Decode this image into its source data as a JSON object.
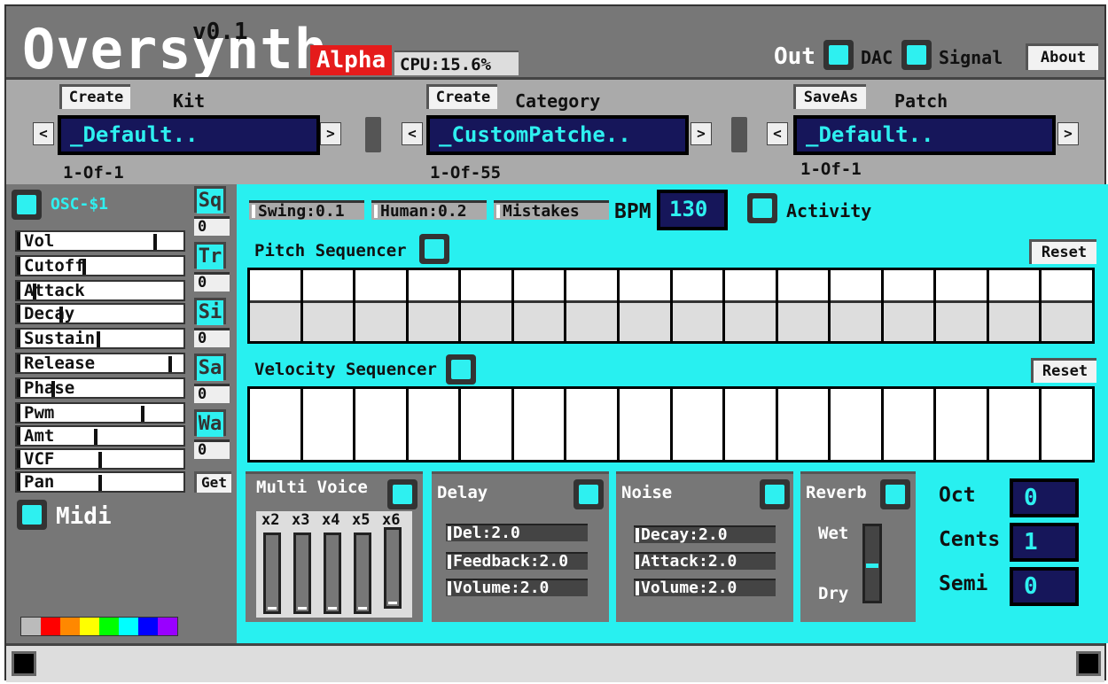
{
  "app": {
    "title": "Oversynth",
    "version": "v0.1",
    "stage": "Alpha",
    "cpu": "CPU:15.6%"
  },
  "header": {
    "out_label": "Out",
    "dac_label": "DAC",
    "signal_label": "Signal",
    "about_label": "About"
  },
  "patchbar": {
    "kit": {
      "button": "Create",
      "label": "Kit",
      "value": "_Default..",
      "count": "1-Of-1",
      "prev": "<",
      "next": ">"
    },
    "category": {
      "button": "Create",
      "label": "Category",
      "value": "_CustomPatche..",
      "count": "1-Of-55",
      "prev": "<",
      "next": ">"
    },
    "patch": {
      "button": "SaveAs",
      "label": "Patch",
      "value": "_Default..",
      "count": "1-Of-1",
      "prev": "<",
      "next": ">"
    }
  },
  "left": {
    "osc_label": "OSC-$1",
    "params": [
      {
        "label": "Vol",
        "value": 0.85
      },
      {
        "label": "Cutoff",
        "value": 0.4
      },
      {
        "label": "Attack",
        "value": 0.08
      },
      {
        "label": "Decay",
        "value": 0.25
      },
      {
        "label": "Sustain",
        "value": 0.49
      },
      {
        "label": "Release",
        "value": 0.95
      },
      {
        "label": "Phase",
        "value": 0.2
      },
      {
        "label": "Pwm",
        "value": 0.77
      },
      {
        "label": "Amt",
        "value": 0.47
      },
      {
        "label": "VCF",
        "value": 0.5
      },
      {
        "label": "Pan",
        "value": 0.5
      }
    ],
    "tags": [
      {
        "label": "Sq",
        "value": "0"
      },
      {
        "label": "Tr",
        "value": "0"
      },
      {
        "label": "Si",
        "value": "0"
      },
      {
        "label": "Sa",
        "value": "0"
      },
      {
        "label": "Wa",
        "value": "0"
      }
    ],
    "get_label": "Get",
    "midi_label": "Midi",
    "palette": [
      "#bbbbbb",
      "#ff0000",
      "#ff8800",
      "#ffff00",
      "#00ff00",
      "#00ffff",
      "#0000ff",
      "#9900ff"
    ]
  },
  "main": {
    "swing": "Swing:0.1",
    "human": "Human:0.2",
    "mistakes": "Mistakes",
    "bpm_label": "BPM",
    "bpm_value": "130",
    "activity_label": "Activity",
    "pitch_label": "Pitch Sequencer",
    "velocity_label": "Velocity Sequencer",
    "reset_label": "Reset",
    "steps": 16,
    "multivoice": {
      "label": "Multi Voice",
      "voices": [
        "x2",
        "x3",
        "x4",
        "x5",
        "x6"
      ]
    },
    "delay": {
      "label": "Delay",
      "params": [
        "Del:2.0",
        "Feedback:2.0",
        "Volume:2.0"
      ]
    },
    "noise": {
      "label": "Noise",
      "params": [
        "Decay:2.0",
        "Attack:2.0",
        "Volume:2.0"
      ]
    },
    "reverb": {
      "label": "Reverb",
      "wet": "Wet",
      "dry": "Dry",
      "level": 0.55
    },
    "tuning": [
      {
        "label": "Oct",
        "value": "0"
      },
      {
        "label": "Cents",
        "value": "1"
      },
      {
        "label": "Semi",
        "value": "0"
      }
    ]
  }
}
